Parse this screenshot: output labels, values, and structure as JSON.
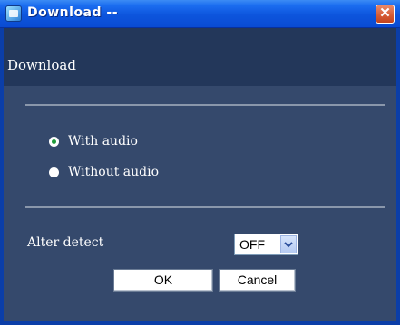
{
  "window": {
    "title": "Download --",
    "close_label": "✕"
  },
  "header": {
    "title": "Download"
  },
  "audio_options": [
    {
      "label": "With audio",
      "checked": true
    },
    {
      "label": "Without audio",
      "checked": false
    }
  ],
  "alter_detect": {
    "label": "Alter detect",
    "value": "OFF"
  },
  "buttons": {
    "ok": "OK",
    "cancel": "Cancel"
  },
  "colors": {
    "titlebar": "#0d55dd",
    "content_bg": "#35496c",
    "header_bg": "#23375a",
    "radio_checked": "#1e9b3a"
  }
}
